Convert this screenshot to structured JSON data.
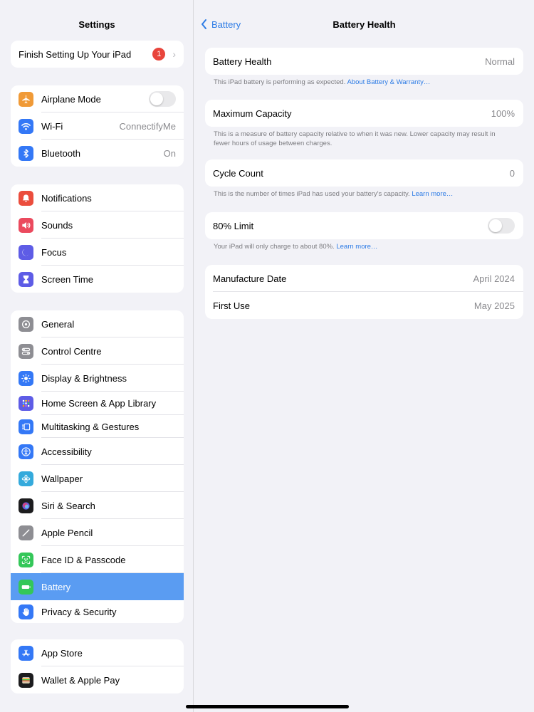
{
  "sidebar": {
    "title": "Settings",
    "setup": {
      "label": "Finish Setting Up Your iPad",
      "badge": "1"
    },
    "connectivity": [
      {
        "label": "Airplane Mode",
        "icon": "airplane-icon",
        "color": "#f09a37"
      },
      {
        "label": "Wi-Fi",
        "value": "ConnectifyMe",
        "icon": "wifi-icon",
        "color": "#3478f6"
      },
      {
        "label": "Bluetooth",
        "value": "On",
        "icon": "bluetooth-icon",
        "color": "#3478f6"
      }
    ],
    "notifications": [
      {
        "label": "Notifications",
        "icon": "bell-icon",
        "color": "#eb4d3d"
      },
      {
        "label": "Sounds",
        "icon": "speaker-icon",
        "color": "#eb4a5e"
      },
      {
        "label": "Focus",
        "icon": "moon-icon",
        "color": "#5e5ce6"
      },
      {
        "label": "Screen Time",
        "icon": "hourglass-icon",
        "color": "#5e5ce6"
      }
    ],
    "general": [
      {
        "label": "General",
        "icon": "gear-icon",
        "color": "#8e8e93"
      },
      {
        "label": "Control Centre",
        "icon": "switches-icon",
        "color": "#8e8e93"
      },
      {
        "label": "Display & Brightness",
        "icon": "sun-icon",
        "color": "#3478f6"
      },
      {
        "label": "Home Screen & App Library",
        "icon": "grid-icon",
        "color": "#5e5ce6"
      },
      {
        "label": "Multitasking & Gestures",
        "icon": "multitask-icon",
        "color": "#3478f6"
      },
      {
        "label": "Accessibility",
        "icon": "accessibility-icon",
        "color": "#3478f6"
      },
      {
        "label": "Wallpaper",
        "icon": "flower-icon",
        "color": "#34aadc"
      },
      {
        "label": "Siri & Search",
        "icon": "siri-icon",
        "color": "#1c1c1e"
      },
      {
        "label": "Apple Pencil",
        "icon": "pencil-icon",
        "color": "#8e8e93"
      },
      {
        "label": "Face ID & Passcode",
        "icon": "faceid-icon",
        "color": "#34c759"
      },
      {
        "label": "Battery",
        "icon": "battery-icon",
        "color": "#34c759"
      },
      {
        "label": "Privacy & Security",
        "icon": "hand-icon",
        "color": "#3478f6"
      }
    ],
    "store": [
      {
        "label": "App Store",
        "icon": "appstore-icon",
        "color": "#3478f6"
      },
      {
        "label": "Wallet & Apple Pay",
        "icon": "wallet-icon",
        "color": "#1c1c1e"
      }
    ]
  },
  "detail": {
    "back_label": "Battery",
    "title": "Battery Health",
    "health": {
      "label": "Battery Health",
      "value": "Normal"
    },
    "health_note": "This iPad battery is performing as expected.",
    "health_link": "About Battery & Warranty…",
    "capacity": {
      "label": "Maximum Capacity",
      "value": "100%"
    },
    "capacity_note": "This is a measure of battery capacity relative to when it was new. Lower capacity may result in fewer hours of usage between charges.",
    "cycle": {
      "label": "Cycle Count",
      "value": "0"
    },
    "cycle_note": "This is the number of times iPad has used your battery's capacity.",
    "cycle_link": "Learn more…",
    "limit": {
      "label": "80% Limit",
      "enabled": false
    },
    "limit_note": "Your iPad will only charge to about 80%.",
    "limit_link": "Learn more…",
    "manufacture": {
      "label": "Manufacture Date",
      "value": "April 2024"
    },
    "first_use": {
      "label": "First Use",
      "value": "May 2025"
    }
  },
  "colors": {
    "accent": "#2c7be5",
    "selected": "#5a9cf2",
    "badge": "#e8453c"
  }
}
